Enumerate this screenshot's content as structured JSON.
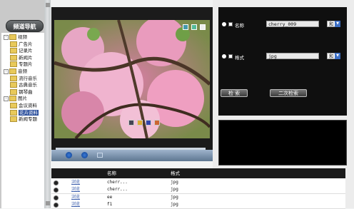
{
  "nav": {
    "title": "频道导航",
    "tree": [
      {
        "label": "视频",
        "level": 0,
        "expand": "-"
      },
      {
        "label": "广告片",
        "level": 1
      },
      {
        "label": "记录片",
        "level": 1
      },
      {
        "label": "新闻片",
        "level": 1
      },
      {
        "label": "专题片",
        "level": 1
      },
      {
        "label": "音频",
        "level": 0,
        "expand": "-"
      },
      {
        "label": "流行音乐",
        "level": 1
      },
      {
        "label": "古典音乐",
        "level": 1
      },
      {
        "label": "钢琴曲",
        "level": 1
      },
      {
        "label": "图片",
        "level": 0,
        "expand": "-"
      },
      {
        "label": "会议资料",
        "level": 1
      },
      {
        "label": "花卉资料",
        "level": 1,
        "selected": true
      },
      {
        "label": "新闻专题",
        "level": 1
      }
    ]
  },
  "form": {
    "name_label": "名称",
    "name_value": "cherry_009",
    "name_op": "和",
    "format_label": "格式",
    "format_value": "jpg",
    "format_op": "和",
    "search_button": "检 索",
    "secondary_search_button": "二次检索"
  },
  "table": {
    "headers": [
      "名称",
      "格式"
    ],
    "rows": [
      {
        "action": "浏览",
        "name": "cherr...",
        "format": "jpg"
      },
      {
        "action": "浏览",
        "name": "cherr...",
        "format": "jpg"
      },
      {
        "action": "浏览",
        "name": "ee",
        "format": "jpg"
      },
      {
        "action": "浏览",
        "name": "f1",
        "format": "jpg"
      }
    ]
  },
  "colors": {
    "selected": "#2b4f9c",
    "player_bar": "#5e7691",
    "form_bg": "#0f0f0f"
  }
}
